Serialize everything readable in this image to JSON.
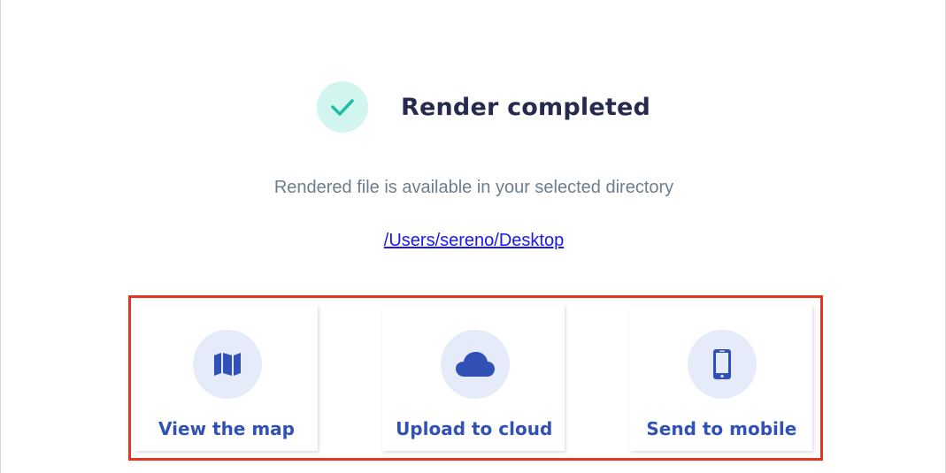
{
  "status": {
    "title": "Render completed",
    "icon": "check-icon",
    "accent_color": "#1bbfa5"
  },
  "message": "Rendered file is available in your selected directory",
  "directory_link": "/Users/sereno/Desktop",
  "actions": [
    {
      "label": "View the map",
      "icon": "map-icon"
    },
    {
      "label": "Upload to cloud",
      "icon": "cloud-icon"
    },
    {
      "label": "Send to mobile",
      "icon": "mobile-phone-icon"
    }
  ],
  "colors": {
    "title": "#262a4f",
    "action_text": "#3251b6",
    "highlight_border": "#e8341c",
    "link": "#1a18f0"
  }
}
